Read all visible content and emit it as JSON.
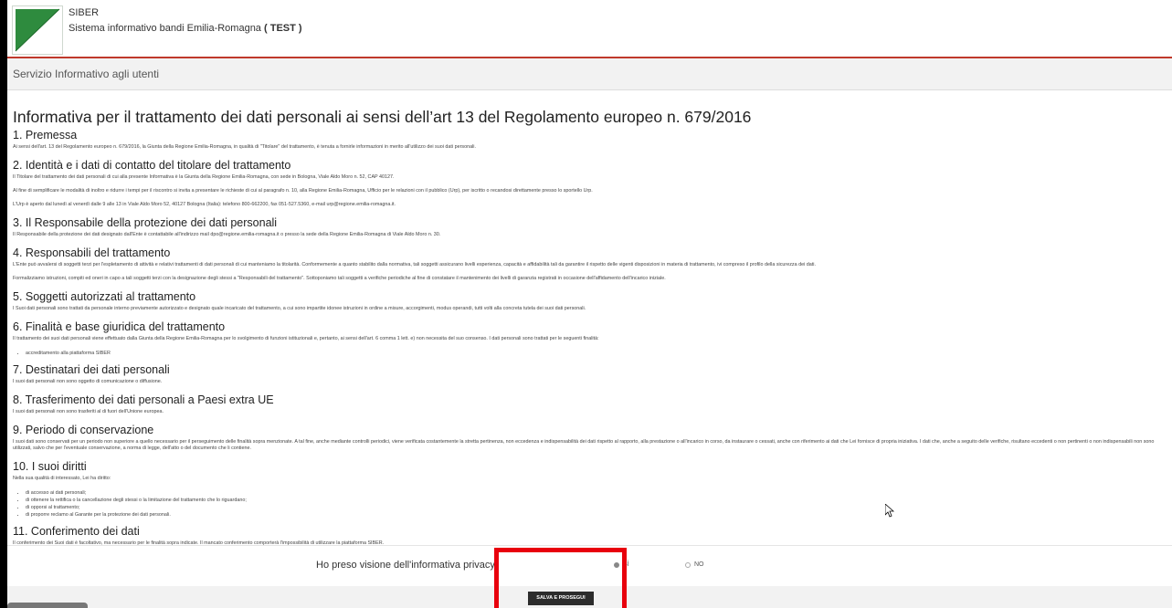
{
  "header": {
    "app_name": "SIBER",
    "subtitle": "Sistema informativo bandi Emilia-Romagna",
    "env": "( TEST )"
  },
  "service_bar": {
    "title": "Servizio Informativo agli utenti"
  },
  "main_title": "Informativa per il trattamento dei dati personali ai sensi dell’art 13 del Regolamento europeo n. 679/2016",
  "sections": {
    "s1": {
      "title": "1. Premessa",
      "p1": "Ai sensi dell'art. 13 del Regolamento europeo n. 679/2016, la Giunta della Regione Emilia-Romagna, in qualità di \"Titolare\" del trattamento, è tenuta a fornirle informazioni in merito all'utilizzo dei suoi dati personali."
    },
    "s2": {
      "title": "2. Identità e i dati di contatto del titolare del trattamento",
      "p1": "Il Titolare del trattamento dei dati personali di cui alla presente Informativa è la Giunta della Regione Emilia-Romagna, con sede in Bologna, Viale Aldo Moro n. 52, CAP 40127.",
      "p2": "Al fine di semplificare le modalità di inoltro e ridurre i tempi per il riscontro si invita a presentare le richieste di cui al paragrafo n. 10, alla Regione Emilia-Romagna, Ufficio per le relazioni con il pubblico (Urp), per iscritto o recandosi direttamente presso lo sportello Urp.",
      "p3": "L'Urp è aperto dal lunedì al venerdì dalle 9 alle 13 in Viale Aldo Moro 52, 40127 Bologna (Italia): telefono 800-662200, fax 051-527.5360, e-mail urp@regione.emilia-romagna.it."
    },
    "s3": {
      "title": "3. Il Responsabile della protezione dei dati personali",
      "p1": "Il Responsabile della protezione dei dati designato dall'Ente è contattabile all'indirizzo mail dpo@regione.emilia-romagna.it o presso la sede della Regione Emilia-Romagna di Viale Aldo Moro n. 30."
    },
    "s4": {
      "title": "4. Responsabili del trattamento",
      "p1": "L'Ente può avvalersi di soggetti terzi per l'espletamento di attività e relativi trattamenti di dati personali di cui manteniamo la titolarità. Conformemente a quanto stabilito dalla normativa, tali soggetti assicurano livelli esperienza, capacità e affidabilità tali da garantire il rispetto delle vigenti disposizioni in materia di trattamento, ivi compreso il profilo della sicurezza dei dati.",
      "p2": "Formalizziamo istruzioni, compiti ed oneri in capo a tali soggetti terzi con la designazione degli stessi a \"Responsabili del trattamento\". Sottoponiamo tali soggetti a verifiche periodiche al fine di constatare il mantenimento dei livelli di garanzia registrati in occasione dell'affidamento dell'incarico iniziale."
    },
    "s5": {
      "title": "5. Soggetti autorizzati al trattamento",
      "p1": "I Suoi dati personali sono trattati da personale interno previamente autorizzato e designato quale incaricato del trattamento, a cui sono impartite idonee istruzioni in ordine a misure, accorgimenti, modus operandi, tutti volti alla concreta tutela dei suoi dati personali."
    },
    "s6": {
      "title": "6. Finalità e base giuridica del trattamento",
      "p1": "Il trattamento dei suoi dati personali viene effettuato dalla Giunta della Regione Emilia-Romagna per lo svolgimento di funzioni istituzionali e, pertanto, ai sensi dell'art. 6 comma 1 lett. e) non necessita del suo consenso. I dati personali sono trattati per le seguenti finalità:",
      "li1": "accreditamento alla piattaforma SIBER"
    },
    "s7": {
      "title": "7. Destinatari dei dati personali",
      "p1": "I suoi dati personali non sono oggetto di comunicazione o diffusione."
    },
    "s8": {
      "title": "8. Trasferimento dei dati personali a Paesi extra UE",
      "p1": "I suoi dati personali non sono trasferiti al di fuori dell'Unione europea."
    },
    "s9": {
      "title": "9. Periodo di conservazione",
      "p1": "I suoi dati sono conservati per un periodo non superiore a quello necessario per il perseguimento delle finalità sopra menzionate. A tal fine, anche mediante controlli periodici, viene verificata costantemente la stretta pertinenza, non eccedenza e indispensabilità dei dati rispetto al rapporto, alla prestazione o all'incarico in corso, da instaurare o cessati, anche con riferimento ai dati che Lei fornisce di propria iniziativa. I dati che, anche a seguito delle verifiche, risultano eccedenti o non pertinenti o non indispensabili non sono utilizzati, salvo che per l'eventuale conservazione, a norma di legge, dell'atto o del documento che li contiene."
    },
    "s10": {
      "title": "10. I suoi diritti",
      "p1": "Nella sua qualità di interessato, Lei ha diritto:",
      "li1": "di accesso ai dati personali;",
      "li2": "di ottenere la rettifica o la cancellazione degli stessi o la limitazione del trattamento che lo riguardano;",
      "li3": "di opporsi al trattamento;",
      "li4": "di proporre reclamo al Garante per la protezione dei dati personali."
    },
    "s11": {
      "title": "11. Conferimento dei dati",
      "p1": "Il conferimento dei Suoi dati è facoltativo, ma necessario per le finalità sopra indicate. Il mancato conferimento comporterà l'impossibilità di utilizzare la piattaforma SIBER."
    }
  },
  "privacy": {
    "label": "Ho preso visione dell'informativa privacy:",
    "yes": "SÌ",
    "no": "NO",
    "selected": "yes"
  },
  "save_button": "SALVA E PROSEGUI",
  "colors": {
    "header_accent": "#c0392b",
    "logo_green": "#2e8b3e",
    "highlight": "#e8000d",
    "button_bg": "#2c2c2c"
  }
}
